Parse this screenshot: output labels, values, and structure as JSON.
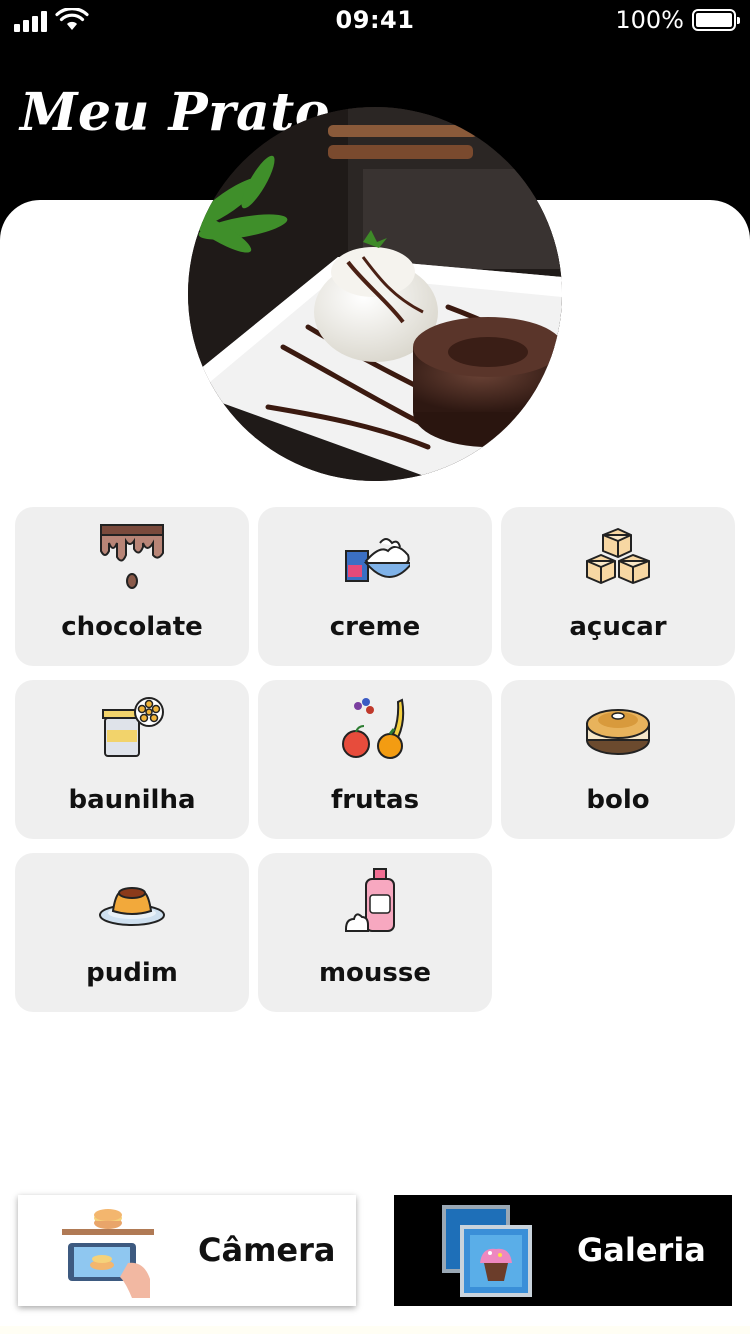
{
  "status_bar": {
    "time": "09:41",
    "battery": "100%"
  },
  "app": {
    "title": "Meu Prato"
  },
  "categories": [
    {
      "label": "chocolate",
      "icon": "chocolate-drip-icon"
    },
    {
      "label": "creme",
      "icon": "cream-bowl-icon"
    },
    {
      "label": "açucar",
      "icon": "sugar-cubes-icon"
    },
    {
      "label": "baunilha",
      "icon": "vanilla-jar-icon"
    },
    {
      "label": "frutas",
      "icon": "fruits-icon"
    },
    {
      "label": "bolo",
      "icon": "cake-icon"
    },
    {
      "label": "pudim",
      "icon": "pudding-icon"
    },
    {
      "label": "mousse",
      "icon": "mousse-spray-icon"
    }
  ],
  "actions": {
    "camera_label": "Câmera",
    "gallery_label": "Galeria"
  },
  "colors": {
    "header_bg": "#000000",
    "card_bg": "#efefef",
    "sheet_bg": "#ffffff"
  }
}
